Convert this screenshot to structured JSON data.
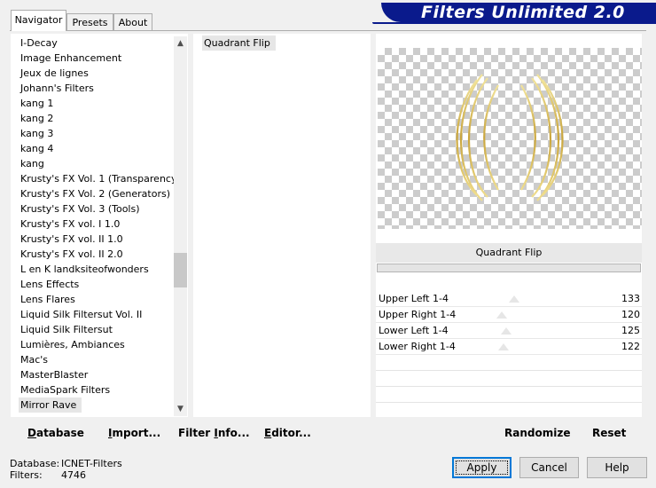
{
  "tabs": [
    {
      "label": "Navigator",
      "active": true
    },
    {
      "label": "Presets",
      "active": false
    },
    {
      "label": "About",
      "active": false
    }
  ],
  "banner": {
    "title": "Filters Unlimited 2.0",
    "color": "#0a1a8c"
  },
  "categories": {
    "items": [
      "I-Decay",
      "Image Enhancement",
      "Jeux de lignes",
      "Johann's Filters",
      "kang 1",
      "kang 2",
      "kang 3",
      "kang 4",
      "kang",
      "Krusty's FX Vol. 1 (Transparency)",
      "Krusty's FX Vol. 2 (Generators)",
      "Krusty's FX Vol. 3 (Tools)",
      "Krusty's FX vol. I 1.0",
      "Krusty's FX vol. II 1.0",
      "Krusty's FX vol. II 2.0",
      "L en K landksiteofwonders",
      "Lens Effects",
      "Lens Flares",
      "Liquid Silk Filtersut Vol. II",
      "Liquid Silk Filtersut",
      "Lumières, Ambiances",
      "Mac's",
      "MasterBlaster",
      "MediaSpark Filters",
      "Mirror Rave"
    ],
    "selected": "Mirror Rave"
  },
  "filters": {
    "items": [
      "Quadrant Flip"
    ],
    "selected": "Quadrant Flip"
  },
  "filter_name": "Quadrant Flip",
  "sliders": [
    {
      "label": "Upper Left 1-4",
      "value": "133",
      "level": 133
    },
    {
      "label": "Upper Right 1-4",
      "value": "120",
      "level": 120
    },
    {
      "label": "Lower Left 1-4",
      "value": "125",
      "level": 125
    },
    {
      "label": "Lower Right 1-4",
      "value": "122",
      "level": 122
    }
  ],
  "slider_max": 255,
  "left_buttons": {
    "database": {
      "pre": "",
      "u": "D",
      "post": "atabase"
    },
    "import": {
      "pre": "",
      "u": "I",
      "post": "mport..."
    },
    "filter_info": {
      "pre": "Filter ",
      "u": "I",
      "post": "nfo..."
    },
    "editor": {
      "pre": "",
      "u": "E",
      "post": "ditor..."
    }
  },
  "right_buttons": {
    "randomize": "Randomize",
    "reset": "Reset"
  },
  "status": {
    "database_label": "Database:",
    "database_value": "ICNET-Filters",
    "filters_label": "Filters:",
    "filters_value": "4746"
  },
  "dialog_buttons": {
    "apply": "Apply",
    "cancel": "Cancel",
    "help": "Help"
  }
}
